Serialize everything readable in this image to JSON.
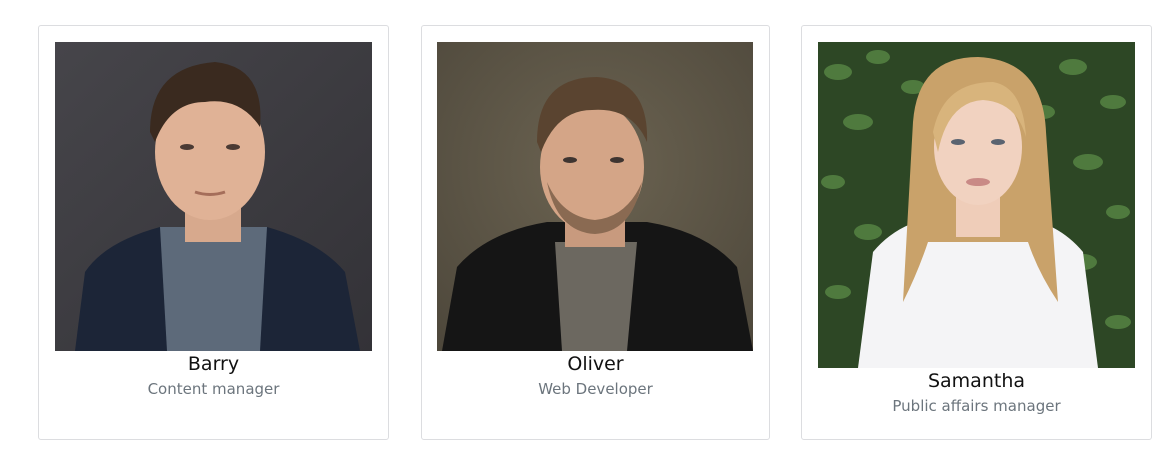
{
  "team": [
    {
      "name": "Barry",
      "role": "Content manager",
      "photo_icon": "person-photo",
      "backdrop_color": "#3c3b40"
    },
    {
      "name": "Oliver",
      "role": "Web Developer",
      "photo_icon": "person-photo",
      "backdrop_color": "#5e5748"
    },
    {
      "name": "Samantha",
      "role": "Public affairs manager",
      "photo_icon": "person-photo",
      "backdrop_color": "#2f4b26"
    }
  ]
}
